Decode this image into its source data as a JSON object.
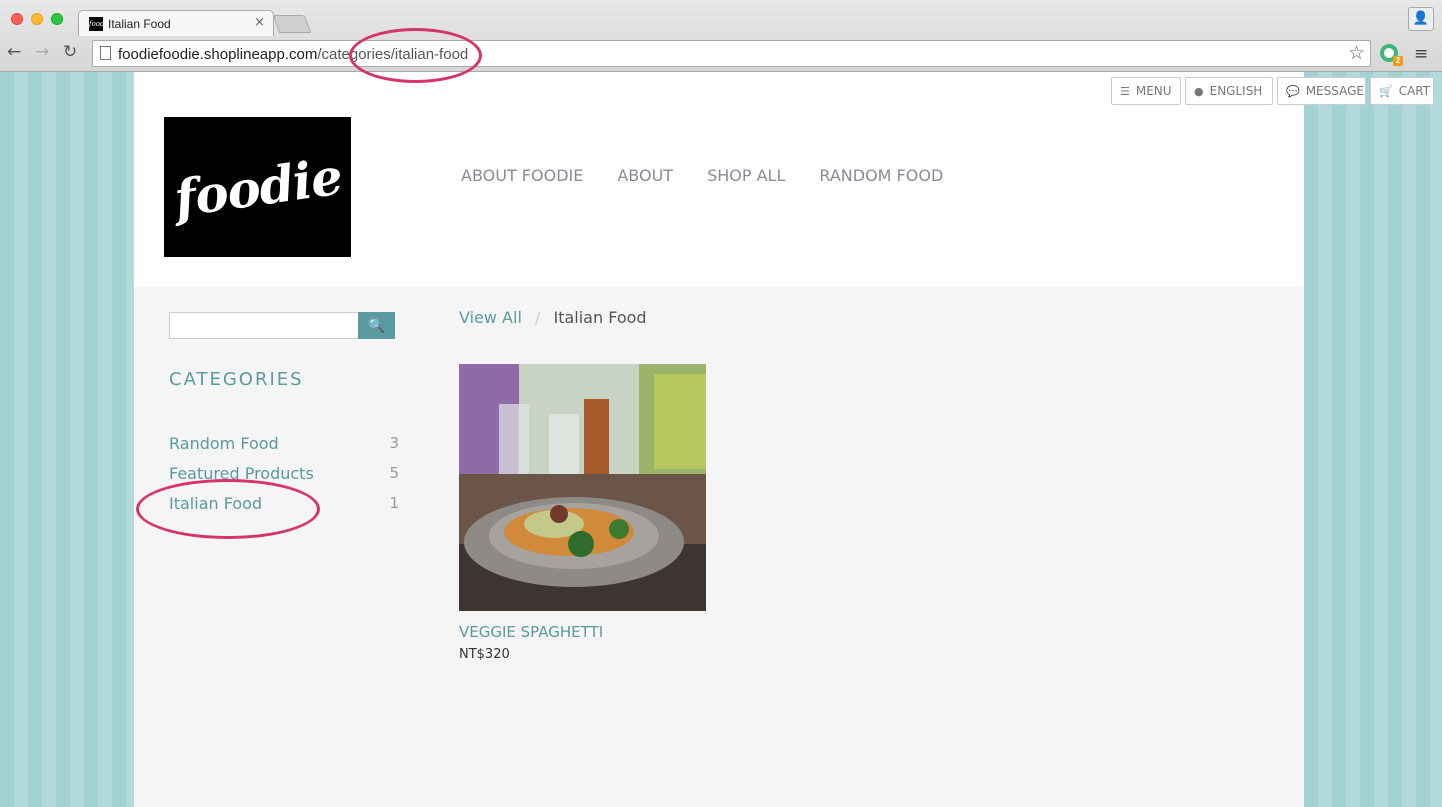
{
  "browser": {
    "tab_title": "Italian Food",
    "tab_favicon_text": "foodie",
    "tab_close": "×",
    "url_main": "foodiefoodie.shoplineapp.com",
    "url_path": "/categories/italian-food",
    "ext_badge": "2"
  },
  "header": {
    "logo_text": "foodie",
    "top_buttons": {
      "menu": "MENU",
      "language": "ENGLISH",
      "message": "MESSAGE",
      "cart": "CART"
    },
    "nav": [
      "ABOUT FOODIE",
      "ABOUT",
      "SHOP ALL",
      "RANDOM FOOD"
    ]
  },
  "sidebar": {
    "search_value": "",
    "categories_title": "CATEGORIES",
    "categories": [
      {
        "name": "Random Food",
        "count": "3"
      },
      {
        "name": "Featured Products",
        "count": "5"
      },
      {
        "name": "Italian Food",
        "count": "1"
      }
    ]
  },
  "breadcrumb": {
    "link": "View All",
    "separator": "/",
    "current": "Italian Food"
  },
  "products": [
    {
      "name": "VEGGIE SPAGHETTI",
      "price": "NT$320"
    }
  ],
  "colors": {
    "accent": "#5a9aa0",
    "annotation": "#d6336c",
    "background_stripes": "#a8d4d6"
  },
  "icons": {
    "menu": "hamburger-icon",
    "language": "globe-icon",
    "message": "chat-bubble-icon",
    "cart": "cart-icon",
    "search": "search-icon"
  }
}
